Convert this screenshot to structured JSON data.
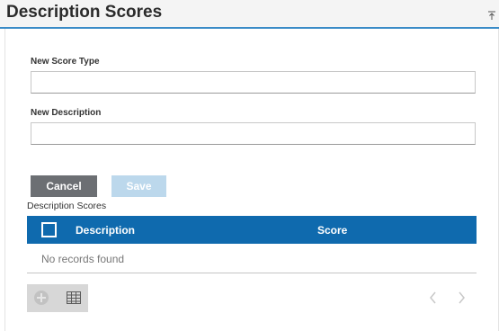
{
  "panel": {
    "title": "Description Scores"
  },
  "form": {
    "score_type_label": "New Score Type",
    "score_type_value": "",
    "description_label": "New Description",
    "description_value": ""
  },
  "actions": {
    "cancel_label": "Cancel",
    "save_label": "Save"
  },
  "table": {
    "caption": "Description Scores",
    "columns": [
      "Description",
      "Score"
    ],
    "rows": [],
    "empty_message": "No records found"
  },
  "colors": {
    "accent": "#0f6aae",
    "header_rule": "#3a8bc7",
    "cancel_bg": "#6c6f73",
    "save_disabled_bg": "#bcd8ec"
  },
  "icons": {
    "collapse": "collapse-up-icon",
    "add": "add-circle-icon",
    "grid": "table-grid-icon",
    "prev": "chevron-left-icon",
    "next": "chevron-right-icon"
  }
}
